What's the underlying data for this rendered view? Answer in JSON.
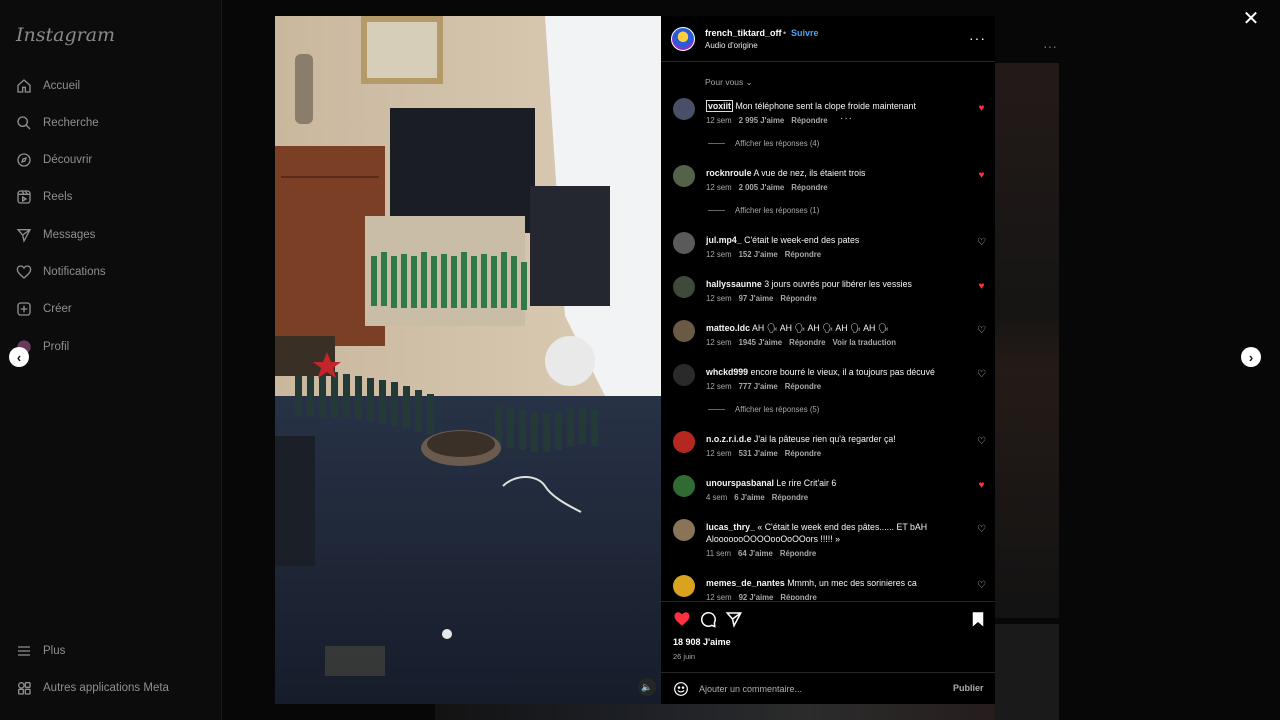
{
  "sidebar": {
    "logo": "Instagram",
    "items": [
      {
        "label": "Accueil",
        "icon": "home-icon"
      },
      {
        "label": "Recherche",
        "icon": "search-icon"
      },
      {
        "label": "Découvrir",
        "icon": "compass-icon"
      },
      {
        "label": "Reels",
        "icon": "reels-icon"
      },
      {
        "label": "Messages",
        "icon": "send-icon"
      },
      {
        "label": "Notifications",
        "icon": "heart-icon"
      },
      {
        "label": "Créer",
        "icon": "plus-square-icon"
      },
      {
        "label": "Profil",
        "icon": "avatar-icon"
      }
    ],
    "more": {
      "label": "Plus",
      "icon": "menu-icon"
    },
    "meta": {
      "label": "Autres applications Meta",
      "icon": "meta-apps-icon"
    }
  },
  "post": {
    "username": "french_tiktard_off",
    "separator": "•",
    "follow_label": "Suivre",
    "audio": "Audio d'origine",
    "sort_label": "Pour vous",
    "comments": [
      {
        "user": "voxiit",
        "text": "Mon téléphone sent la clope froide maintenant",
        "time": "12 sem",
        "likes": "2 995 J'aime",
        "reply": "Répondre",
        "liked": true,
        "avatar": "#4a4f68",
        "replies": "Afficher les réponses (4)"
      },
      {
        "user": "rocknroule",
        "text": "A vue de nez, ils étaient trois",
        "time": "12 sem",
        "likes": "2 005 J'aime",
        "reply": "Répondre",
        "liked": true,
        "avatar": "#55624a",
        "replies": "Afficher les réponses (1)"
      },
      {
        "user": "jul.mp4_",
        "text": "C'était le week-end des pates",
        "time": "12 sem",
        "likes": "152 J'aime",
        "reply": "Répondre",
        "liked": false,
        "avatar": "#5a5a5a"
      },
      {
        "user": "hallyssaunne",
        "text": "3 jours ouvrés pour libérer les vessies",
        "time": "12 sem",
        "likes": "97 J'aime",
        "reply": "Répondre",
        "liked": true,
        "avatar": "#3f4a3a"
      },
      {
        "user": "matteo.ldc",
        "text": "AH 🗣 AH 🗣 AH 🗣 AH 🗣 AH 🗣",
        "time": "12 sem",
        "likes": "1945 J'aime",
        "reply": "Répondre",
        "translate": "Voir la traduction",
        "liked": false,
        "avatar": "#6a5a44"
      },
      {
        "user": "whckd999",
        "text": "encore bourré le vieux, il a toujours pas décuvé",
        "time": "12 sem",
        "likes": "777 J'aime",
        "reply": "Répondre",
        "liked": false,
        "avatar": "#2a2a2a",
        "replies": "Afficher les réponses (5)"
      },
      {
        "user": "n.o.z.r.i.d.e",
        "text": "J'ai la pâteuse rien qu'à regarder ça!",
        "time": "12 sem",
        "likes": "531 J'aime",
        "reply": "Répondre",
        "liked": false,
        "avatar": "#b5281f"
      },
      {
        "user": "unourspasbanal",
        "text": "Le rire Crit'air 6",
        "time": "4 sem",
        "likes": "6 J'aime",
        "reply": "Répondre",
        "liked": true,
        "avatar": "#2f6b32"
      },
      {
        "user": "lucas_thry_",
        "text": "« C'était le week end des pâtes...... ET bAH AlooooooOOOOooOoOOors !!!!! »",
        "time": "11 sem",
        "likes": "64 J'aime",
        "reply": "Répondre",
        "liked": false,
        "avatar": "#8a7458"
      },
      {
        "user": "memes_de_nantes",
        "text": "Mmmh, un mec des sorinieres ca",
        "time": "12 sem",
        "likes": "92 J'aime",
        "reply": "Répondre",
        "liked": false,
        "avatar": "#d9a21f"
      }
    ],
    "likes_count": "18 908 J'aime",
    "date": "26 juin",
    "comment_placeholder": "Ajouter un commentaire...",
    "publish_label": "Publier",
    "liked": true
  },
  "colors": {
    "accent": "#4aa3f5",
    "like": "#ff3040",
    "background": "#000000"
  }
}
